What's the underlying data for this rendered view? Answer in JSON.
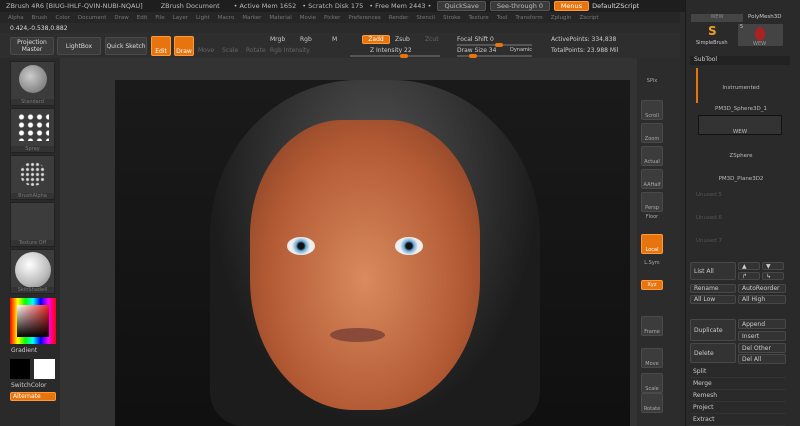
{
  "title": {
    "app": "ZBrush 4R6 [BIUG-IHLF-QVIN-NUBI-NQAU]",
    "doc": "ZBrush Document",
    "active_mem": "• Active Mem 1652",
    "scratch": "• Scratch Disk 175",
    "free_mem": "• Free Mem 2443 •",
    "quicksave": "QuickSave",
    "seethrough": "See-through  0",
    "menus": "Menus",
    "script": "DefaultZScript"
  },
  "menu": [
    "Alpha",
    "Brush",
    "Color",
    "Document",
    "Draw",
    "Edit",
    "File",
    "Layer",
    "Light",
    "Macro",
    "Marker",
    "Material",
    "Movie",
    "Picker",
    "Preferences",
    "Render",
    "Stencil",
    "Stroke",
    "Texture",
    "Tool",
    "Transform",
    "Zplugin",
    "Zscript"
  ],
  "coords": "0.424,-0.538,0.882",
  "toolbar": {
    "projection_master": "Projection Master",
    "lightbox": "LightBox",
    "quick_sketch": "Quick Sketch",
    "edit": "Edit",
    "draw": "Draw",
    "move": "Move",
    "scale": "Scale",
    "rotate": "Rotate",
    "mrgb": "Mrgb",
    "rgb": "Rgb",
    "m": "M",
    "rgb_intensity": "Rgb Intensity",
    "zadd": "Zadd",
    "zsub": "Zsub",
    "zcut": "Zcut",
    "z_intensity": "Z Intensity 22",
    "focal_shift": "Focal Shift 0",
    "draw_size": "Draw Size 34",
    "dynamic": "Dynamic",
    "active_points": "ActivePoints: 334,838",
    "total_points": "TotalPoints: 23.988 Mil"
  },
  "left": {
    "brush": "Standard",
    "stroke": "Spray",
    "alpha": "BrushAlpha",
    "texture": "Texture Off",
    "material": "SkinShade4",
    "gradient": "Gradient",
    "switch_color": "SwitchColor",
    "alternate": "Alternate"
  },
  "rshelf": [
    "SPix",
    "Scroll",
    "Zoom",
    "Actual",
    "AAHalf",
    "Persp",
    "Floor",
    "Local",
    "L.Sym",
    "Xyz",
    "Frame",
    "Move",
    "Scale",
    "Rotate"
  ],
  "rpanel": {
    "tool_a": "WEW",
    "tool_b": "PolyMesh3D",
    "simplebrush": "SimpleBrush",
    "wew": "WEW",
    "count": "5",
    "subtool_title": "SubTool",
    "subtools": [
      "Instrumented",
      "PM3D_Sphere3D_1",
      "WEW",
      "ZSphere",
      "PM3D_Plane3D2"
    ],
    "unused": [
      "Unused 5",
      "Unused 6",
      "Unused 7"
    ],
    "list_all": "List All",
    "rename": "Rename",
    "autoreorder": "AutoReorder",
    "all_low": "All Low",
    "all_high": "All High",
    "duplicate": "Duplicate",
    "append": "Append",
    "insert": "Insert",
    "delete": "Delete",
    "del_other": "Del Other",
    "del_all": "Del All",
    "split": "Split",
    "merge": "Merge",
    "remesh": "Remesh",
    "project": "Project",
    "extract": "Extract"
  }
}
